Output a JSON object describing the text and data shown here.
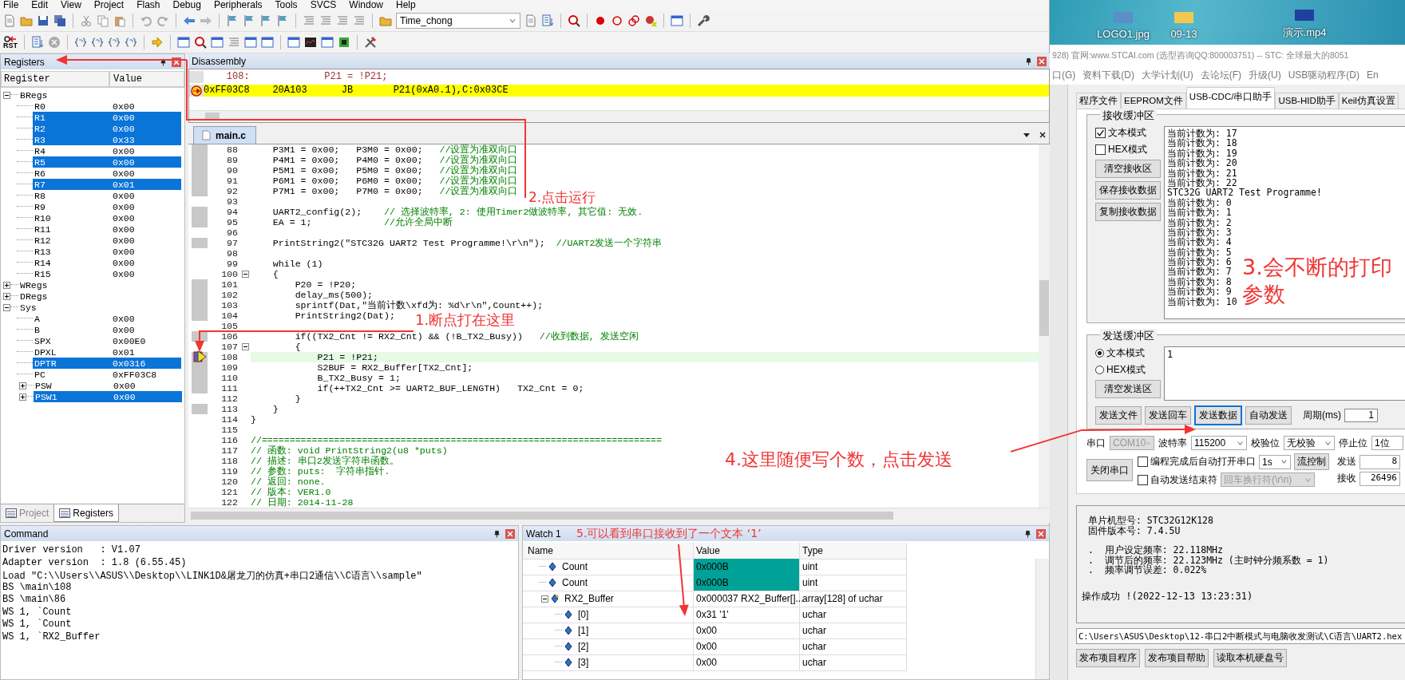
{
  "menu_bar": [
    "File",
    "Edit",
    "View",
    "Project",
    "Flash",
    "Debug",
    "Peripherals",
    "Tools",
    "SVCS",
    "Window",
    "Help"
  ],
  "toolbar": {
    "target": "Time_chong",
    "reset_label": "RST"
  },
  "registers": {
    "title": "Registers",
    "columns": [
      "Register",
      "Value"
    ],
    "tree": [
      {
        "name": "BRegs",
        "expanded": true,
        "children": [
          {
            "name": "R0",
            "value": "0x00",
            "selected": false
          },
          {
            "name": "R1",
            "value": "0x00",
            "selected": true
          },
          {
            "name": "R2",
            "value": "0x00",
            "selected": true
          },
          {
            "name": "R3",
            "value": "0x33",
            "selected": true
          },
          {
            "name": "R4",
            "value": "0x00",
            "selected": false
          },
          {
            "name": "R5",
            "value": "0x00",
            "selected": true
          },
          {
            "name": "R6",
            "value": "0x00",
            "selected": false
          },
          {
            "name": "R7",
            "value": "0x01",
            "selected": true
          },
          {
            "name": "R8",
            "value": "0x00",
            "selected": false
          },
          {
            "name": "R9",
            "value": "0x00",
            "selected": false
          },
          {
            "name": "R10",
            "value": "0x00",
            "selected": false
          },
          {
            "name": "R11",
            "value": "0x00",
            "selected": false
          },
          {
            "name": "R12",
            "value": "0x00",
            "selected": false
          },
          {
            "name": "R13",
            "value": "0x00",
            "selected": false
          },
          {
            "name": "R14",
            "value": "0x00",
            "selected": false
          },
          {
            "name": "R15",
            "value": "0x00",
            "selected": false
          }
        ]
      },
      {
        "name": "WRegs",
        "expanded": false
      },
      {
        "name": "DRegs",
        "expanded": false
      },
      {
        "name": "Sys",
        "expanded": true,
        "children": [
          {
            "name": "A",
            "value": "0x00",
            "selected": false
          },
          {
            "name": "B",
            "value": "0x00",
            "selected": false
          },
          {
            "name": "SPX",
            "value": "0x00E0",
            "selected": false
          },
          {
            "name": "DPXL",
            "value": "0x01",
            "selected": false
          },
          {
            "name": "DPTR",
            "value": "0x0316",
            "selected": true
          },
          {
            "name": "PC",
            "value": "0xFF03C8",
            "selected": false
          },
          {
            "name": "PSW",
            "value": "0x00",
            "selected": false,
            "expanded": false
          },
          {
            "name": "PSW1",
            "value": "0x00",
            "selected": true,
            "expanded": false
          }
        ]
      }
    ]
  },
  "panel_tabs": [
    {
      "label": "Project",
      "selected": false
    },
    {
      "label": "Registers",
      "selected": true
    }
  ],
  "disassembly": {
    "title": "Disassembly",
    "lines": [
      {
        "kind": "source",
        "text": "    108:             P21 = !P21;",
        "current": false
      },
      {
        "kind": "instruction",
        "text": "0xFF03C8    20A103      JB       P21(0xA0.1),C:0x03CE",
        "current": true
      }
    ]
  },
  "editor": {
    "tab": "main.c",
    "lines": [
      {
        "number": "88",
        "code": "    P3M1 = 0x00;   P3M0 = 0x00;   ",
        "comment": "//设置为准双向口",
        "executable": true,
        "current": false
      },
      {
        "number": "89",
        "code": "    P4M1 = 0x00;   P4M0 = 0x00;   ",
        "comment": "//设置为准双向口",
        "executable": true,
        "current": false
      },
      {
        "number": "90",
        "code": "    P5M1 = 0x00;   P5M0 = 0x00;   ",
        "comment": "//设置为准双向口",
        "executable": true,
        "current": false
      },
      {
        "number": "91",
        "code": "    P6M1 = 0x00;   P6M0 = 0x00;   ",
        "comment": "//设置为准双向口",
        "executable": true,
        "current": false
      },
      {
        "number": "92",
        "code": "    P7M1 = 0x00;   P7M0 = 0x00;   ",
        "comment": "//设置为准双向口",
        "executable": true,
        "current": false
      },
      {
        "number": "93",
        "executable": false,
        "current": false
      },
      {
        "number": "94",
        "code": "    UART2_config(2);    ",
        "comment": "// 选择波特率, 2: 使用Timer2做波特率, 其它值: 无效.",
        "executable": true,
        "current": false
      },
      {
        "number": "95",
        "code": "    EA = 1;             ",
        "comment": "//允许全局中断",
        "executable": true,
        "current": false
      },
      {
        "number": "96",
        "executable": false,
        "current": false
      },
      {
        "number": "97",
        "code": "    PrintString2(\"STC32G UART2 Test Programme!\\r\\n\");  ",
        "comment": "//UART2发送一个字符串",
        "executable": true,
        "current": false
      },
      {
        "number": "98",
        "executable": false,
        "current": false
      },
      {
        "number": "99",
        "code": "    while (1)",
        "executable": false,
        "current": false
      },
      {
        "number": "100",
        "code": "    {",
        "fold": true,
        "executable": false,
        "current": false
      },
      {
        "number": "101",
        "code": "        P20 = !P20;",
        "executable": true,
        "current": false
      },
      {
        "number": "102",
        "code": "        delay_ms(500);",
        "executable": true,
        "current": false
      },
      {
        "number": "103",
        "code": "        sprintf(Dat,\"当前计数\\xfd为: %d\\r\\n\",Count++);",
        "executable": true,
        "current": false
      },
      {
        "number": "104",
        "code": "        PrintString2(Dat);",
        "executable": true,
        "current": false
      },
      {
        "number": "105",
        "executable": false,
        "current": false
      },
      {
        "number": "106",
        "code": "        if((TX2_Cnt != RX2_Cnt) && (!B_TX2_Busy))   ",
        "comment": "//收到数据, 发送空闲",
        "executable": true,
        "current": false
      },
      {
        "number": "107",
        "code": "        {",
        "fold": true,
        "executable": false,
        "current": false
      },
      {
        "number": "108",
        "code": "            P21 = !P21;",
        "executable": true,
        "current": true
      },
      {
        "number": "109",
        "code": "            S2BUF = RX2_Buffer[TX2_Cnt];",
        "executable": true,
        "current": false
      },
      {
        "number": "110",
        "code": "            B_TX2_Busy = 1;",
        "executable": true,
        "current": false
      },
      {
        "number": "111",
        "code": "            if(++TX2_Cnt >= UART2_BUF_LENGTH)   TX2_Cnt = 0;",
        "executable": true,
        "current": false
      },
      {
        "number": "112",
        "code": "        }",
        "executable": false,
        "current": false
      },
      {
        "number": "113",
        "code": "    }",
        "executable": true,
        "current": false
      },
      {
        "number": "114",
        "code": "}",
        "executable": false,
        "current": false
      },
      {
        "number": "115",
        "executable": false,
        "current": false
      },
      {
        "number": "116",
        "comment": "//========================================================================",
        "executable": false,
        "current": false
      },
      {
        "number": "117",
        "comment": "// 函数: void PrintString2(u8 *puts)",
        "executable": false,
        "current": false
      },
      {
        "number": "118",
        "comment": "// 描述: 串口2发送字符串函数。",
        "executable": false,
        "current": false
      },
      {
        "number": "119",
        "comment": "// 参数: puts:  字符串指针.",
        "executable": false,
        "current": false
      },
      {
        "number": "120",
        "comment": "// 返回: none.",
        "executable": false,
        "current": false
      },
      {
        "number": "121",
        "comment": "// 版本: VER1.0",
        "executable": false,
        "current": false
      },
      {
        "number": "122",
        "comment": "// 日期: 2014-11-28",
        "executable": false,
        "current": false
      }
    ]
  },
  "command": {
    "title": "Command",
    "lines": [
      "Driver version   : V1.07",
      "Adapter version  : 1.8 (6.55.45)",
      "Load \"C:\\\\Users\\\\ASUS\\\\Desktop\\\\LINK1D&屠龙刀的仿真+串口2通信\\\\C语言\\\\sample\"",
      "BS \\main\\108",
      "BS \\main\\86",
      "WS 1, `Count",
      "WS 1, `Count",
      "WS 1, `RX2_Buffer"
    ]
  },
  "watch": {
    "title": "Watch 1",
    "columns": [
      "Name",
      "Value",
      "Type"
    ],
    "rows": [
      {
        "name": "Count",
        "value": "0x000B",
        "type": "uint",
        "changed": true
      },
      {
        "name": "Count",
        "value": "0x000B",
        "type": "uint",
        "changed": true
      },
      {
        "name": "RX2_Buffer",
        "value": "0x000037 RX2_Buffer[]...",
        "type": "array[128] of uchar",
        "changed": false,
        "expanded": true,
        "children": [
          {
            "name": "[0]",
            "value": "0x31 '1'",
            "type": "uchar",
            "changed": false
          },
          {
            "name": "[1]",
            "value": "0x00",
            "type": "uchar",
            "changed": false
          },
          {
            "name": "[2]",
            "value": "0x00",
            "type": "uchar",
            "changed": false
          },
          {
            "name": "[3]",
            "value": "0x00",
            "type": "uchar",
            "changed": false
          }
        ]
      }
    ]
  },
  "desktop": {
    "icons": [
      {
        "label": "LOGO1.jpg",
        "kind": "image"
      },
      {
        "label": "09-13",
        "kind": "folder"
      },
      {
        "label": "演示.mp4",
        "kind": "video"
      }
    ]
  },
  "isp": {
    "title": "928) 官网:www.STCAI.com  (选型咨询QQ:800003751) -- STC: 全球最大的8051",
    "menu": [
      "口(G)",
      "资料下载(D)",
      "大学计划(U)",
      "去论坛(F)",
      "升级(U)",
      "USB驱动程序(D)",
      "En"
    ],
    "tabs": [
      {
        "label": "程序文件",
        "selected": false
      },
      {
        "label": "EEPROM文件",
        "selected": false
      },
      {
        "label": "USB-CDC/串口助手",
        "selected": true
      },
      {
        "label": "USB-HID助手",
        "selected": false
      },
      {
        "label": "Keil仿真设置",
        "selected": false
      }
    ],
    "receive": {
      "title": "接收缓冲区",
      "options": [
        {
          "label": "文本模式",
          "checked": true
        },
        {
          "label": "HEX模式",
          "checked": false
        }
      ],
      "buttons": [
        "清空接收区",
        "保存接收数据",
        "复制接收数据"
      ],
      "text": [
        "当前计数为: 17",
        "当前计数为: 18",
        "当前计数为: 19",
        "当前计数为: 20",
        "当前计数为: 21",
        "当前计数为: 22",
        "STC32G UART2 Test Programme!",
        "当前计数为: 0",
        "当前计数为: 1",
        "当前计数为: 2",
        "当前计数为: 3",
        "当前计数为: 4",
        "当前计数为: 5",
        "当前计数为: 6",
        "当前计数为: 7",
        "当前计数为: 8",
        "当前计数为: 9",
        "当前计数为: 10"
      ]
    },
    "send": {
      "title": "发送缓冲区",
      "options": [
        {
          "label": "文本模式",
          "selected": true
        },
        {
          "label": "HEX模式",
          "selected": false
        }
      ],
      "clear_button": "清空发送区",
      "value": "1",
      "actions": [
        {
          "label": "发送文件",
          "focused": false
        },
        {
          "label": "发送回车",
          "focused": false
        },
        {
          "label": "发送数据",
          "focused": true
        },
        {
          "label": "自动发送",
          "focused": false
        }
      ],
      "period_label": "周期(ms)",
      "period": "1"
    },
    "port": {
      "port_label": "串口",
      "port": {
        "value": "COM10",
        "disabled": true
      },
      "baud_label": "波特率",
      "baud": "115200",
      "parity_label": "校验位",
      "parity": "无校验",
      "stop_label": "停止位",
      "stop": "1位",
      "close_button": "关闭串口",
      "auto_open": {
        "label": "编程完成后自动打开串口",
        "checked": false
      },
      "delay": "1s",
      "flow_button": "流控制",
      "auto_end": {
        "label": "自动发送结束符",
        "checked": false
      },
      "end_char": {
        "value": "回车换行符(\\r\\n)",
        "disabled": true
      },
      "sent_label": "发送",
      "sent": "8",
      "received_label": "接收",
      "received": "26496"
    },
    "info_groups": [
      {
        "lines": [
          "单片机型号: STC32G12K128",
          "固件版本号: 7.4.5U"
        ]
      },
      {
        "lines": [
          ".  用户设定频率: 22.118MHz",
          ".  调节后的频率: 22.123MHz (主时钟分频系数 = 1)",
          ".  频率调节误差: 0.022%"
        ]
      }
    ],
    "status": "操作成功 !(2022-12-13 13:23:31)",
    "path": "C:\\Users\\ASUS\\Desktop\\12-串口2中断模式与电脑收发测试\\C语言\\UART2.hex",
    "bottom_buttons": [
      "发布项目程序",
      "发布项目帮助",
      "读取本机硬盘号"
    ]
  },
  "annotations": [
    {
      "text": "1.断点打在这里"
    },
    {
      "text": "2.点击运行"
    },
    {
      "text": "3.会不断的打印参数"
    },
    {
      "text": "4.这里随便写个数，点击发送"
    },
    {
      "text": "5.可以看到串口接收到了一个文本 ‘1’"
    }
  ]
}
